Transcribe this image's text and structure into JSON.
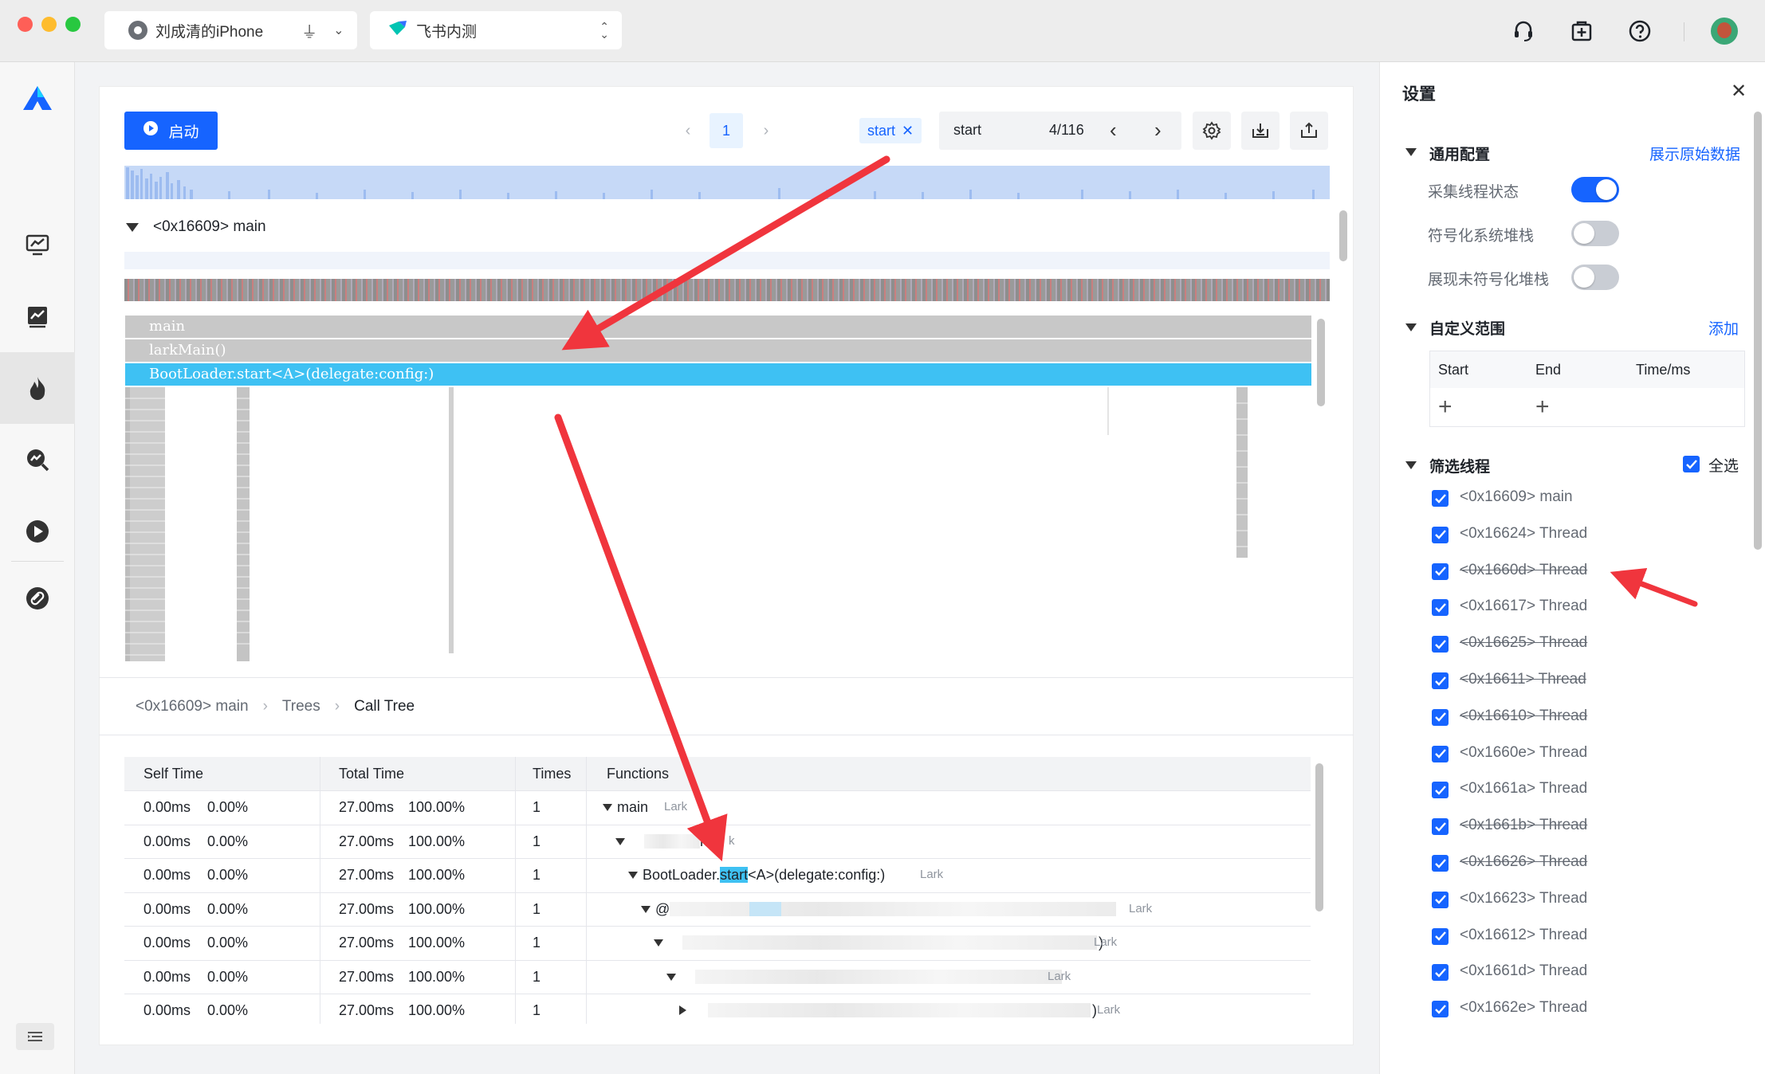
{
  "titlebar": {
    "device_name": "刘成清的iPhone",
    "app_name": "飞书内测"
  },
  "toolbar": {
    "start_button_label": "启动",
    "page_number": "1",
    "search_tag": "start",
    "search_value": "start",
    "search_count": "4/116"
  },
  "thread_header": "<0x16609> main",
  "flame": {
    "rows": [
      "main",
      "larkMain()",
      "BootLoader.start<A>(delegate:config:)"
    ]
  },
  "breadcrumb": {
    "items": [
      "<0x16609> main",
      "Trees",
      "Call Tree"
    ]
  },
  "call_tree": {
    "columns": [
      "Self Time",
      "Total Time",
      "Times",
      "Functions"
    ],
    "rows": [
      {
        "self_ms": "0.00ms",
        "self_pct": "0.00%",
        "total_ms": "27.00ms",
        "total_pct": "100.00%",
        "times": "1",
        "func": "main",
        "lib": "Lark",
        "indent": 0,
        "expand": "open"
      },
      {
        "self_ms": "0.00ms",
        "self_pct": "0.00%",
        "total_ms": "27.00ms",
        "total_pct": "100.00%",
        "times": "1",
        "func": "n()",
        "lib": "k",
        "indent": 1,
        "expand": "open"
      },
      {
        "self_ms": "0.00ms",
        "self_pct": "0.00%",
        "total_ms": "27.00ms",
        "total_pct": "100.00%",
        "times": "1",
        "func_pre": "BootLoader.",
        "func_hl": "start",
        "func_post": "<A>(delegate:config:)",
        "lib": "Lark",
        "indent": 2,
        "expand": "open"
      },
      {
        "self_ms": "0.00ms",
        "self_pct": "0.00%",
        "total_ms": "27.00ms",
        "total_pct": "100.00%",
        "times": "1",
        "func": "@",
        "lib": "Lark",
        "indent": 3,
        "expand": "open"
      },
      {
        "self_ms": "0.00ms",
        "self_pct": "0.00%",
        "total_ms": "27.00ms",
        "total_pct": "100.00%",
        "times": "1",
        "func": ")",
        "lib": "Lark",
        "indent": 4,
        "expand": "open"
      },
      {
        "self_ms": "0.00ms",
        "self_pct": "0.00%",
        "total_ms": "27.00ms",
        "total_pct": "100.00%",
        "times": "1",
        "func": "",
        "lib": "Lark",
        "indent": 5,
        "expand": "open"
      },
      {
        "self_ms": "0.00ms",
        "self_pct": "0.00%",
        "total_ms": "27.00ms",
        "total_pct": "100.00%",
        "times": "1",
        "func": ")",
        "lib": "Lark",
        "indent": 6,
        "expand": "closed"
      }
    ]
  },
  "settings": {
    "title": "设置",
    "general": {
      "title": "通用配置",
      "link": "展示原始数据",
      "options": [
        {
          "label": "采集线程状态",
          "on": true
        },
        {
          "label": "符号化系统堆栈",
          "on": false
        },
        {
          "label": "展现未符号化堆栈",
          "on": false
        }
      ]
    },
    "custom_range": {
      "title": "自定义范围",
      "add_link": "添加",
      "columns": [
        "Start",
        "End",
        "Time/ms"
      ]
    },
    "thread_filter": {
      "title": "筛选线程",
      "select_all": "全选",
      "threads": [
        {
          "label": "<0x16609> main",
          "struck": false
        },
        {
          "label": "<0x16624> Thread",
          "struck": false
        },
        {
          "label": "<0x1660d> Thread",
          "struck": true
        },
        {
          "label": "<0x16617> Thread",
          "struck": false
        },
        {
          "label": "<0x16625> Thread",
          "struck": true
        },
        {
          "label": "<0x16611> Thread",
          "struck": true
        },
        {
          "label": "<0x16610> Thread",
          "struck": true
        },
        {
          "label": "<0x1660e> Thread",
          "struck": false
        },
        {
          "label": "<0x1661a> Thread",
          "struck": false
        },
        {
          "label": "<0x1661b> Thread",
          "struck": true
        },
        {
          "label": "<0x16626> Thread",
          "struck": true
        },
        {
          "label": "<0x16623> Thread",
          "struck": false
        },
        {
          "label": "<0x16612> Thread",
          "struck": false
        },
        {
          "label": "<0x1661d> Thread",
          "struck": false
        },
        {
          "label": "<0x1662e> Thread",
          "struck": false
        }
      ]
    }
  },
  "colors": {
    "accent": "#1664ff",
    "flame_selected": "#3ec1f3",
    "annotation_arrow": "#f0353d"
  }
}
